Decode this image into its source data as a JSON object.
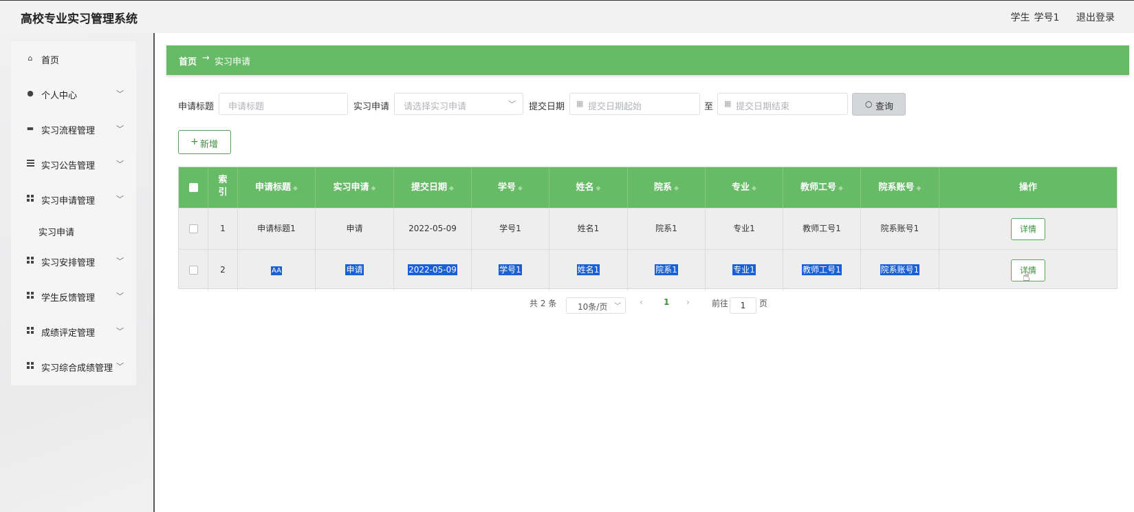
{
  "header": {
    "app_title": "高校专业实习管理系统",
    "user_role": "学生",
    "user_name": "学号1",
    "logout": "退出登录"
  },
  "sidebar": {
    "items": [
      {
        "label": "首页",
        "icon": "home-icon"
      },
      {
        "label": "个人中心",
        "icon": "user-icon"
      },
      {
        "label": "实习流程管理",
        "icon": "briefcase-icon"
      },
      {
        "label": "实习公告管理",
        "icon": "list-icon"
      },
      {
        "label": "实习申请管理",
        "icon": "grid-icon"
      },
      {
        "label": "实习安排管理",
        "icon": "grid-icon"
      },
      {
        "label": "学生反馈管理",
        "icon": "grid-icon"
      },
      {
        "label": "成绩评定管理",
        "icon": "grid-icon"
      },
      {
        "label": "实习综合成绩管理",
        "icon": "grid-icon"
      }
    ],
    "subitem": "实习申请"
  },
  "breadcrumb": {
    "home": "首页",
    "arrow": "→",
    "current": "实习申请"
  },
  "search": {
    "title_label": "申请标题",
    "title_placeholder": "申请标题",
    "apply_label": "实习申请",
    "apply_placeholder": "请选择实习申请",
    "date_label": "提交日期",
    "date_start_placeholder": "提交日期起始",
    "to": "至",
    "date_end_placeholder": "提交日期结束",
    "query_button": "查询"
  },
  "add_button": "新增",
  "table": {
    "headers": [
      "索引",
      "申请标题",
      "实习申请",
      "提交日期",
      "学号",
      "姓名",
      "院系",
      "专业",
      "教师工号",
      "院系账号",
      "操作"
    ],
    "index_header_line1": "索",
    "index_header_line2": "引",
    "rows": [
      {
        "index": "1",
        "title": "申请标题1",
        "apply": "申请",
        "date": "2022-05-09",
        "student_no": "学号1",
        "name": "姓名1",
        "dept": "院系1",
        "major": "专业1",
        "teacher_no": "教师工号1",
        "dept_account": "院系账号1",
        "action": "详情"
      },
      {
        "index": "2",
        "title": "AA",
        "apply": "申请",
        "date": "2022-05-09",
        "student_no": "学号1",
        "name": "姓名1",
        "dept": "院系1",
        "major": "专业1",
        "teacher_no": "教师工号1",
        "dept_account": "院系账号1",
        "action": "详情"
      }
    ]
  },
  "pagination": {
    "total_prefix": "共",
    "total": "2",
    "total_suffix": "条",
    "page_size": "10条/页",
    "current_page": "1",
    "goto_prefix": "前往",
    "goto_value": "1",
    "goto_suffix": "页"
  },
  "colors": {
    "accent_green": "#67bb67",
    "selection_blue": "#1a5fd6"
  }
}
